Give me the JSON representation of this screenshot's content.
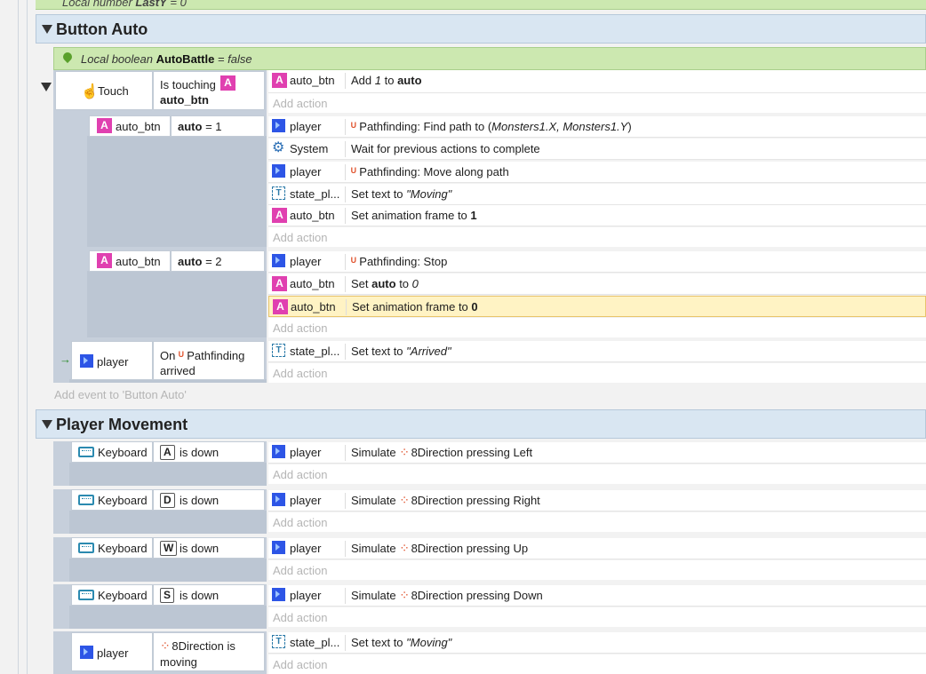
{
  "top_var": {
    "text_a": "Local number ",
    "name": "LastY",
    "text_b": " = 0"
  },
  "groups": [
    {
      "title": "Button Auto",
      "local_var": {
        "prefix": "Local boolean ",
        "name": "AutoBattle",
        "suffix": " = false"
      }
    },
    {
      "title": "Player Movement"
    }
  ],
  "button_auto": {
    "touch_event": {
      "trigger_obj": "Touch",
      "cond_text": "Is touching",
      "cond_obj": "auto_btn",
      "action": {
        "obj": "auto_btn",
        "text_a": "Add ",
        "val": "1",
        "text_b": " to ",
        "var": "auto"
      }
    },
    "sub1": {
      "obj": "auto_btn",
      "cond": "auto",
      "cond_val": " = 1",
      "actions": [
        {
          "obj": "player",
          "text": "Pathfinding: Find path to (",
          "args": "Monsters1.X, Monsters1.Y",
          "close": ")"
        },
        {
          "obj": "System",
          "text": "Wait for previous actions to complete"
        },
        {
          "obj": "player",
          "text": "Pathfinding: Move along path"
        },
        {
          "obj": "state_pl...",
          "text": "Set text to ",
          "val": "\"Moving\""
        },
        {
          "obj": "auto_btn",
          "text": "Set animation frame to ",
          "val": "1"
        }
      ]
    },
    "sub2": {
      "obj": "auto_btn",
      "cond": "auto",
      "cond_val": " = 2",
      "actions": [
        {
          "obj": "player",
          "text": "Pathfinding: Stop"
        },
        {
          "obj": "auto_btn",
          "text_a": "Set ",
          "var": "auto",
          "text_b": " to ",
          "val": "0"
        },
        {
          "obj": "auto_btn",
          "text": "Set animation frame to ",
          "val": "0"
        }
      ]
    },
    "arrived_event": {
      "obj": "player",
      "cond_a": "On",
      "cond_b": "Pathfinding",
      "cond_c": "arrived",
      "action": {
        "obj": "state_pl...",
        "text": "Set text to ",
        "val": "\"Arrived\""
      }
    },
    "add_event": "Add event to 'Button Auto'"
  },
  "add_action": "Add action",
  "movement": {
    "keys": [
      {
        "trigger": "Keyboard",
        "key": "A",
        "cond": "is down",
        "obj": "player",
        "sim": "Simulate ",
        "beh": "8Direction pressing Left"
      },
      {
        "trigger": "Keyboard",
        "key": "D",
        "cond": "is down",
        "obj": "player",
        "sim": "Simulate ",
        "beh": "8Direction pressing Right"
      },
      {
        "trigger": "Keyboard",
        "key": "W",
        "cond": "is down",
        "obj": "player",
        "sim": "Simulate ",
        "beh": "8Direction pressing Up"
      },
      {
        "trigger": "Keyboard",
        "key": "S",
        "cond": "is down",
        "obj": "player",
        "sim": "Simulate ",
        "beh": "8Direction pressing Down"
      }
    ],
    "moving_event": {
      "obj": "player",
      "cond_a": "8Direction is",
      "cond_b": "moving",
      "action": {
        "obj": "state_pl...",
        "text": "Set text to ",
        "val": "\"Moving\""
      }
    }
  },
  "colors": {
    "accent_sprite": "#e040b0",
    "player": "#2d55e6",
    "behavior": "#e0502a",
    "highlight": "#fff3c4"
  }
}
